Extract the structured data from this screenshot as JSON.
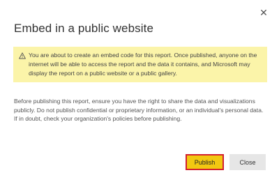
{
  "dialog": {
    "close_glyph": "✕",
    "title": "Embed in a public website",
    "warning": {
      "icon": "warning-triangle-icon",
      "text": "You are about to create an embed code for this report. Once published, anyone on the internet will be able to access the report and the data it contains, and Microsoft may display the report on a public website or a public gallery.",
      "background": "#fbf4a9"
    },
    "body": "Before publishing this report, ensure you have the right to share the data and visualizations publicly. Do not publish confidential or proprietary information, or an individual's personal data. If in doubt, check your organization's policies before publishing.",
    "buttons": {
      "publish_label": "Publish",
      "close_label": "Close"
    },
    "colors": {
      "publish_bg": "#f2c811",
      "publish_highlight_border": "#d2202f",
      "close_bg": "#e6e6e6"
    }
  }
}
